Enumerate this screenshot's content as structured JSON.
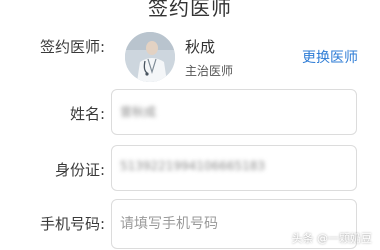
{
  "page": {
    "title": "签约医师"
  },
  "doctor": {
    "label": "签约医师:",
    "name": "秋成",
    "title": "主治医师",
    "change_label": "更换医师",
    "avatar_icon": "doctor-avatar-icon",
    "link_color": "#2f7dd6"
  },
  "form": {
    "name": {
      "label": "姓名:",
      "value": "曾秋成"
    },
    "id_card": {
      "label": "身份证:",
      "value": "5139221994106665183"
    },
    "phone": {
      "label": "手机号码:",
      "value": "",
      "placeholder": "请填写手机号码"
    }
  },
  "watermark": {
    "text": "头条 @一颗奶豆"
  }
}
